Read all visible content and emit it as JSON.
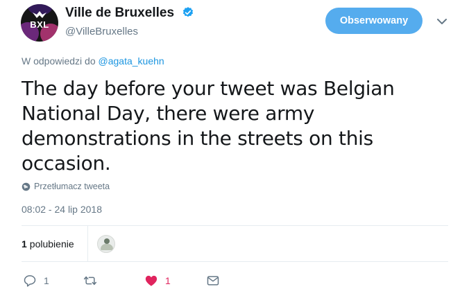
{
  "header": {
    "avatar_text": "BXL",
    "display_name": "Ville de Bruxelles",
    "handle": "@VilleBruxelles",
    "follow_label": "Obserwowany"
  },
  "reply": {
    "prefix": "W odpowiedzi do",
    "mention": "@agata_kuehn"
  },
  "tweet": {
    "text": "The day before your tweet was Belgian National Day, there were army demonstrations in the streets on this occasion.",
    "translate_label": "Przetłumacz tweeta",
    "timestamp": "08:02 - 24 lip 2018"
  },
  "stats": {
    "likes_number": "1",
    "likes_label": "polubienie"
  },
  "actions": {
    "reply_count": "1",
    "retweet_count": "",
    "like_count": "1"
  },
  "colors": {
    "accent": "#55acee",
    "like": "#e0245e",
    "muted": "#657786",
    "link": "#1b95e0"
  },
  "icons": [
    "verified-icon",
    "chevron-down-icon",
    "globe-icon",
    "reply-icon",
    "retweet-icon",
    "heart-icon",
    "envelope-icon"
  ]
}
